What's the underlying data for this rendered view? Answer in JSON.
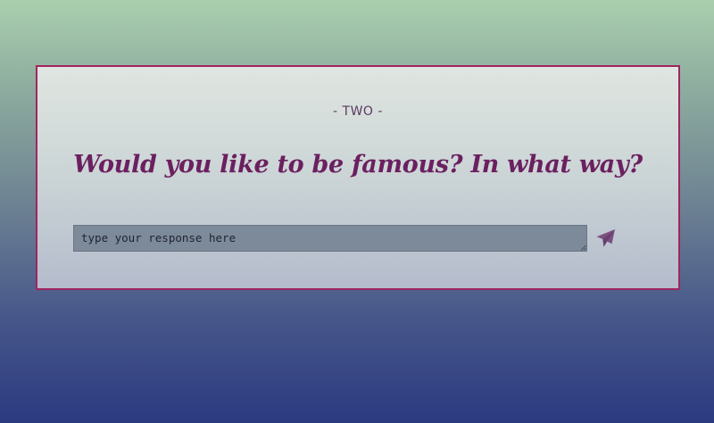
{
  "prompt": {
    "step_label": "- TWO -",
    "question": "Would you like to be famous? In what way?"
  },
  "response": {
    "placeholder": "type your response here",
    "value": ""
  },
  "send_button": {
    "icon": "paper-plane-icon"
  },
  "colors": {
    "card_border": "#a0255f",
    "question_text": "#6b2060",
    "input_background": "#7d8a99",
    "send_icon": "#7b4f7e"
  }
}
